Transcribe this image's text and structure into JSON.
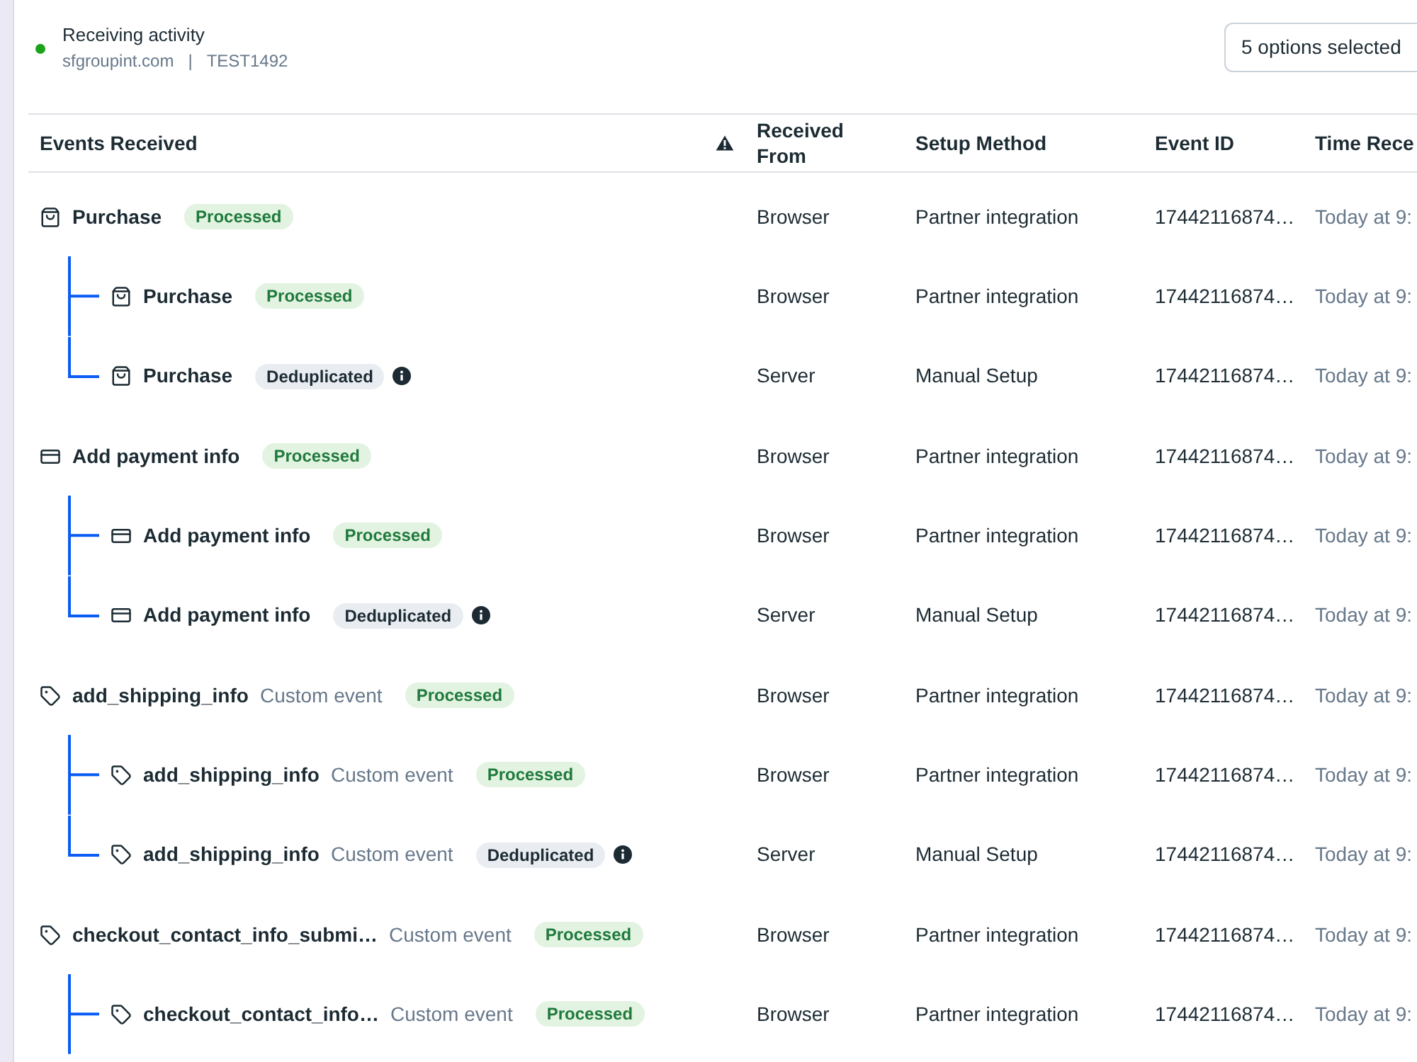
{
  "header": {
    "active": true,
    "title": "Receiving activity",
    "domain": "sfgroupint.com",
    "separator": "|",
    "dataset": "TEST1492"
  },
  "filter": {
    "value": "5 options selected"
  },
  "table": {
    "columns": [
      {
        "label": "Events Received",
        "warning": true
      },
      {
        "label": "Received From",
        "warning": false
      },
      {
        "label": "Setup Method",
        "warning": false
      },
      {
        "label": "Event ID",
        "warning": false
      },
      {
        "label": "Time Rece",
        "warning": false
      }
    ],
    "groups": [
      {
        "kind": "purchase",
        "name": "Purchase",
        "badge": {
          "label": "Processed",
          "kind": "success"
        },
        "info": false,
        "received_from": "Browser",
        "setup_method": "Partner integration",
        "event_id": "17442116874…",
        "time": "Today at 9:",
        "more_below": false,
        "children": [
          {
            "kind": "purchase",
            "name": "Purchase",
            "badge": {
              "label": "Processed",
              "kind": "success"
            },
            "info": false,
            "received_from": "Browser",
            "setup_method": "Partner integration",
            "event_id": "17442116874…",
            "time": "Today at 9:"
          },
          {
            "kind": "purchase",
            "name": "Purchase",
            "badge": {
              "label": "Deduplicated",
              "kind": "neutral"
            },
            "info": true,
            "received_from": "Server",
            "setup_method": "Manual Setup",
            "event_id": "17442116874…",
            "time": "Today at 9:"
          }
        ]
      },
      {
        "kind": "payment",
        "name": "Add payment info",
        "badge": {
          "label": "Processed",
          "kind": "success"
        },
        "info": false,
        "received_from": "Browser",
        "setup_method": "Partner integration",
        "event_id": "17442116874…",
        "time": "Today at 9:",
        "more_below": false,
        "children": [
          {
            "kind": "payment",
            "name": "Add payment info",
            "badge": {
              "label": "Processed",
              "kind": "success"
            },
            "info": false,
            "received_from": "Browser",
            "setup_method": "Partner integration",
            "event_id": "17442116874…",
            "time": "Today at 9:"
          },
          {
            "kind": "payment",
            "name": "Add payment info",
            "badge": {
              "label": "Deduplicated",
              "kind": "neutral"
            },
            "info": true,
            "received_from": "Server",
            "setup_method": "Manual Setup",
            "event_id": "17442116874…",
            "time": "Today at 9:"
          }
        ]
      },
      {
        "kind": "custom",
        "name": "add_shipping_info",
        "subtitle": "Custom event",
        "badge": {
          "label": "Processed",
          "kind": "success"
        },
        "info": false,
        "received_from": "Browser",
        "setup_method": "Partner integration",
        "event_id": "17442116874…",
        "time": "Today at 9:",
        "more_below": false,
        "children": [
          {
            "kind": "custom",
            "name": "add_shipping_info",
            "subtitle": "Custom event",
            "badge": {
              "label": "Processed",
              "kind": "success"
            },
            "info": false,
            "received_from": "Browser",
            "setup_method": "Partner integration",
            "event_id": "17442116874…",
            "time": "Today at 9:"
          },
          {
            "kind": "custom",
            "name": "add_shipping_info",
            "subtitle": "Custom event",
            "badge": {
              "label": "Deduplicated",
              "kind": "neutral"
            },
            "info": true,
            "received_from": "Server",
            "setup_method": "Manual Setup",
            "event_id": "17442116874…",
            "time": "Today at 9:"
          }
        ]
      },
      {
        "kind": "custom",
        "name": "checkout_contact_info_submi…",
        "subtitle": "Custom event",
        "badge": {
          "label": "Processed",
          "kind": "success"
        },
        "info": false,
        "received_from": "Browser",
        "setup_method": "Partner integration",
        "event_id": "17442116874…",
        "time": "Today at 9:",
        "more_below": true,
        "children": [
          {
            "kind": "custom",
            "name": "checkout_contact_info…",
            "subtitle": "Custom event",
            "badge": {
              "label": "Processed",
              "kind": "success"
            },
            "info": false,
            "received_from": "Browser",
            "setup_method": "Partner integration",
            "event_id": "17442116874…",
            "time": "Today at 9:"
          }
        ]
      }
    ]
  }
}
